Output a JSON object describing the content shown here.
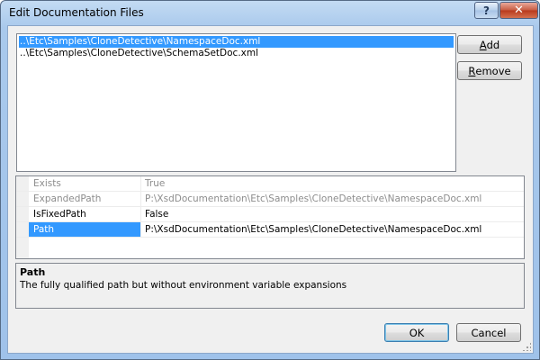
{
  "window": {
    "title": "Edit Documentation Files",
    "help_label": "?",
    "close_label": "✕"
  },
  "files": [
    {
      "path": "..\\Etc\\Samples\\CloneDetective\\NamespaceDoc.xml",
      "selected": true
    },
    {
      "path": "..\\Etc\\Samples\\CloneDetective\\SchemaSetDoc.xml",
      "selected": false
    }
  ],
  "side_buttons": {
    "add_accel": "A",
    "add_rest": "dd",
    "remove_accel": "R",
    "remove_rest": "emove"
  },
  "properties": [
    {
      "name": "Exists",
      "value": "True",
      "readonly": true,
      "selected": false
    },
    {
      "name": "ExpandedPath",
      "value": "P:\\XsdDocumentation\\Etc\\Samples\\CloneDetective\\NamespaceDoc.xml",
      "readonly": true,
      "selected": false
    },
    {
      "name": "IsFixedPath",
      "value": "False",
      "readonly": false,
      "selected": false
    },
    {
      "name": "Path",
      "value": "P:\\XsdDocumentation\\Etc\\Samples\\CloneDetective\\NamespaceDoc.xml",
      "readonly": false,
      "selected": true
    }
  ],
  "description": {
    "title": "Path",
    "text": "The fully qualified path but without environment variable expansions"
  },
  "footer": {
    "ok_label": "OK",
    "cancel_label": "Cancel"
  },
  "colors": {
    "selection": "#3399ff",
    "readonly_text": "#8d8d8d"
  }
}
